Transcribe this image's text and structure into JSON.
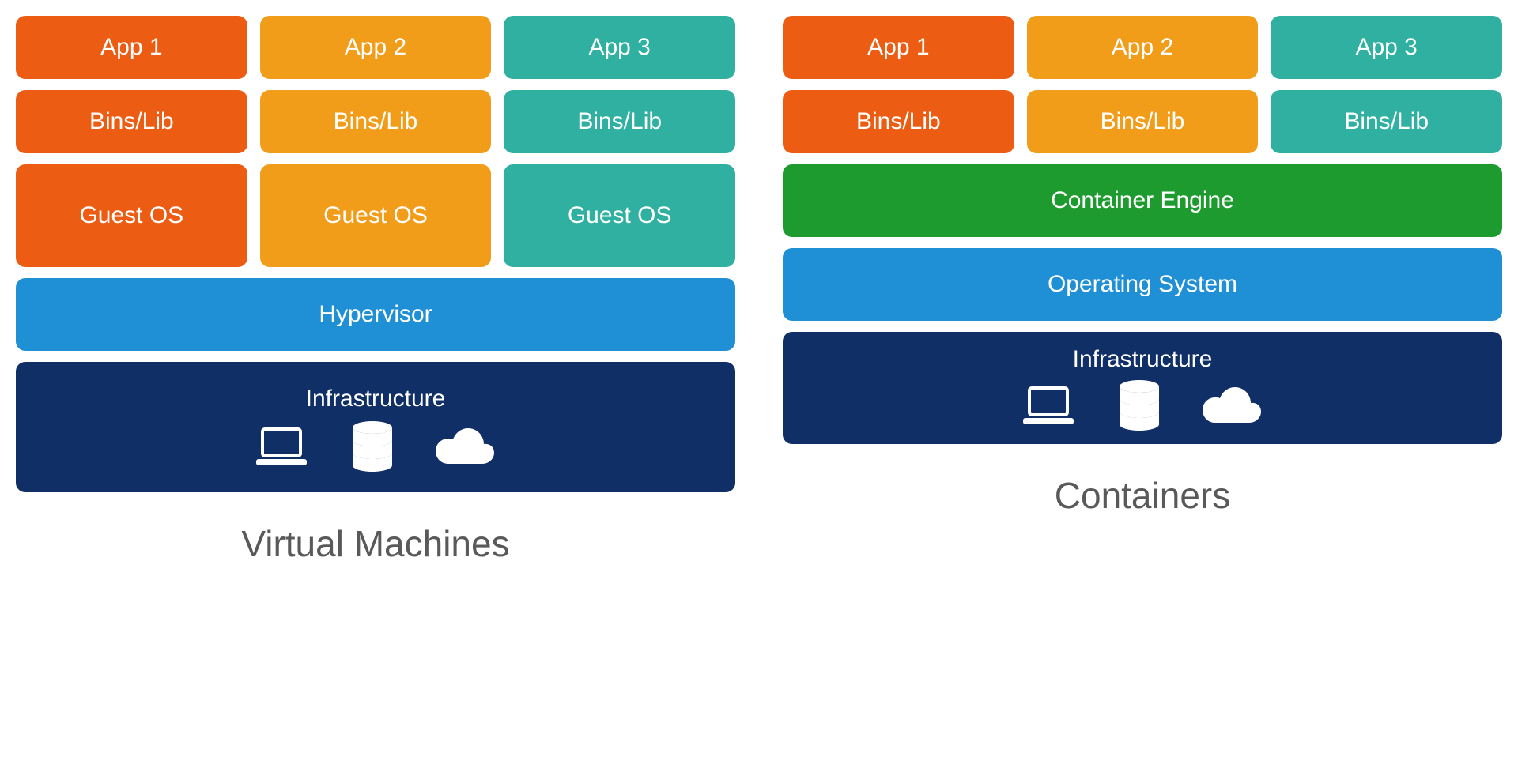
{
  "vm": {
    "title": "Virtual Machines",
    "apps": [
      "App 1",
      "App 2",
      "App 3"
    ],
    "bins": [
      "Bins/Lib",
      "Bins/Lib",
      "Bins/Lib"
    ],
    "guest": [
      "Guest OS",
      "Guest OS",
      "Guest OS"
    ],
    "hypervisor": "Hypervisor",
    "infrastructure": "Infrastructure"
  },
  "ct": {
    "title": "Containers",
    "apps": [
      "App 1",
      "App 2",
      "App 3"
    ],
    "bins": [
      "Bins/Lib",
      "Bins/Lib",
      "Bins/Lib"
    ],
    "engine": "Container Engine",
    "os": "Operating System",
    "infrastructure": "Infrastructure"
  },
  "colors": {
    "orange": "#ed5c13",
    "amber": "#f29d19",
    "teal": "#2fb0a0",
    "green": "#1e9b2f",
    "blue": "#1f8fd6",
    "navy": "#0f2f66"
  }
}
